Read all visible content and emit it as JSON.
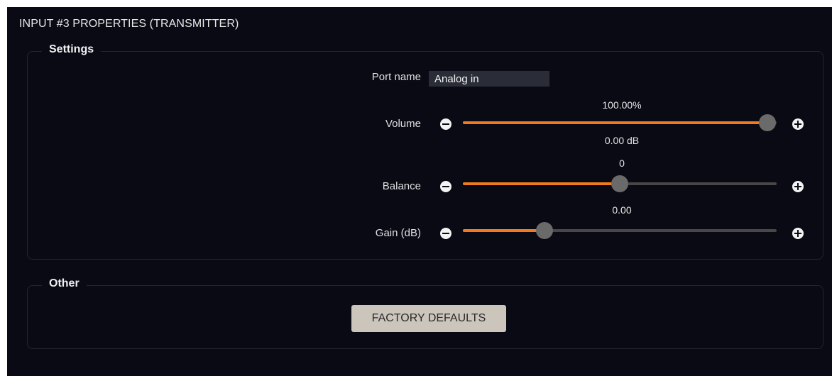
{
  "panel": {
    "title": "INPUT #3 PROPERTIES (TRANSMITTER)"
  },
  "settings": {
    "legend": "Settings",
    "port_name": {
      "label": "Port name",
      "value": "Analog in"
    },
    "volume": {
      "label": "Volume",
      "value_text": "100.00%",
      "sub_text": "0.00 dB",
      "fraction": 0.97
    },
    "balance": {
      "label": "Balance",
      "value_text": "0",
      "fraction": 0.5
    },
    "gain": {
      "label": "Gain (dB)",
      "value_text": "0.00",
      "fraction": 0.26
    },
    "accent_color": "#f07a1e"
  },
  "other": {
    "legend": "Other",
    "factory_defaults_label": "FACTORY DEFAULTS"
  },
  "icons": {
    "decrease": "minus-circle-icon",
    "increase": "plus-circle-icon"
  }
}
